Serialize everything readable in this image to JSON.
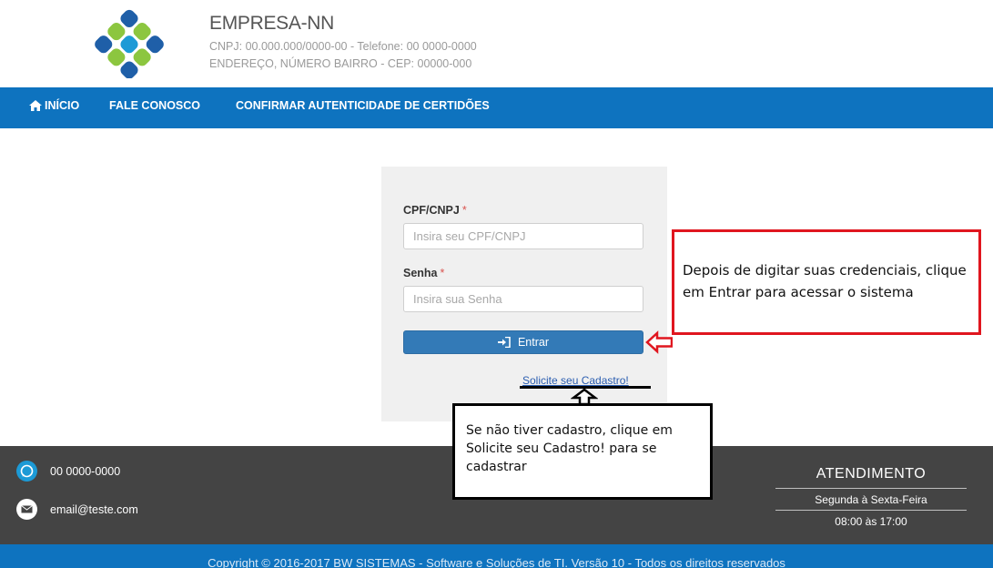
{
  "header": {
    "company_name": "EMPRESA-NN",
    "info_line1": "CNPJ: 00.000.000/0000-00 - Telefone: 00 0000-0000",
    "info_line2": "ENDEREÇO, NÚMERO BAIRRO - CEP: 00000-000"
  },
  "nav": {
    "home": "INÍCIO",
    "contact": "FALE CONOSCO",
    "verify": "CONFIRMAR AUTENTICIDADE DE CERTIDÕES"
  },
  "login": {
    "cpf_label": "CPF/CNPJ",
    "cpf_placeholder": "Insira seu CPF/CNPJ",
    "password_label": "Senha",
    "password_placeholder": "Insira sua Senha",
    "required_mark": "*",
    "submit_label": "Entrar",
    "register_link": "Solicite seu Cadastro!"
  },
  "footer": {
    "phone": "00 0000-0000",
    "email": "email@teste.com",
    "attendance_title": "ATENDIMENTO",
    "attendance_days": "Segunda à Sexta-Feira",
    "attendance_hours": "08:00 às 17:00",
    "copyright": "Copyright © 2016-2017 BW SISTEMAS - Software e Soluções de TI. Versão 10 - Todos os direitos reservados"
  },
  "annotations": {
    "login_hint": "Depois de digitar suas credenciais, clique em Entrar para acessar o sistema",
    "register_hint": "Se não tiver cadastro, clique em Solicite seu Cadastro! para se cadastrar"
  },
  "colors": {
    "nav_blue": "#0e73bf",
    "button_blue": "#337ab7",
    "footer_gray": "#444444",
    "annotation_red": "#e0161f",
    "required_red": "#d9534f"
  },
  "icons": {
    "home": "home-icon",
    "login": "sign-in-icon",
    "phone": "whatsapp-icon",
    "email": "envelope-icon",
    "logo": "company-logo"
  }
}
